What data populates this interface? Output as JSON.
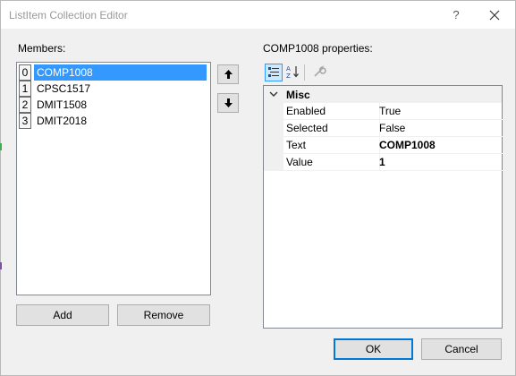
{
  "window": {
    "title": "ListItem Collection Editor",
    "help_glyph": "?"
  },
  "members": {
    "label": "Members:",
    "items": [
      {
        "index": "0",
        "label": "COMP1008",
        "selected": true
      },
      {
        "index": "1",
        "label": "CPSC1517",
        "selected": false
      },
      {
        "index": "2",
        "label": "DMIT1508",
        "selected": false
      },
      {
        "index": "3",
        "label": "DMIT2018",
        "selected": false
      }
    ],
    "add_label": "Add",
    "remove_label": "Remove"
  },
  "properties": {
    "label": "COMP1008 properties:",
    "category": "Misc",
    "rows": [
      {
        "name": "Enabled",
        "value": "True",
        "bold": false
      },
      {
        "name": "Selected",
        "value": "False",
        "bold": false
      },
      {
        "name": "Text",
        "value": "COMP1008",
        "bold": true
      },
      {
        "name": "Value",
        "value": "1",
        "bold": true
      }
    ]
  },
  "footer": {
    "ok_label": "OK",
    "cancel_label": "Cancel"
  },
  "icons": {
    "move_up": "arrow-up-icon",
    "move_down": "arrow-down-icon",
    "categorized": "categorized-icon",
    "alphabetical": "alphabetical-icon",
    "property_pages": "wrench-icon",
    "close": "close-icon",
    "collapse": "chevron-down-icon"
  },
  "colors": {
    "selection": "#3399ff",
    "window_bg": "#f0f0f0",
    "default_button_border": "#0078d7"
  }
}
